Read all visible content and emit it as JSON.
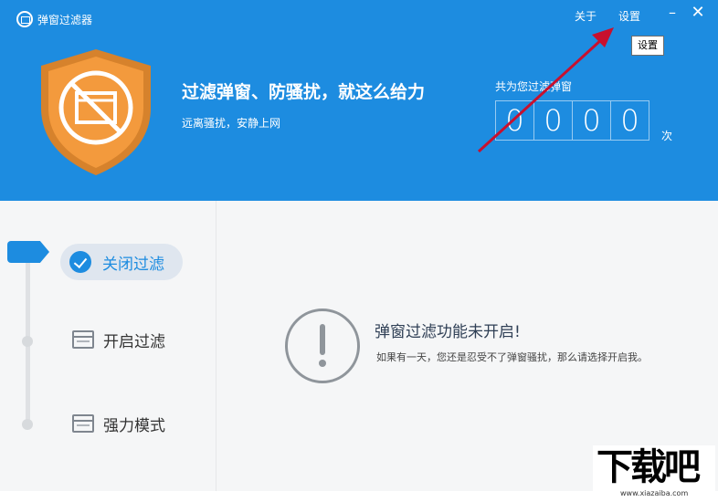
{
  "app": {
    "title": "弹窗过滤器"
  },
  "header": {
    "about": "关于",
    "settings": "设置",
    "tooltip": "设置",
    "headline": "过滤弹窗、防骚扰，就这么给力",
    "subline": "远离骚扰，安静上网",
    "count_label": "共为您过滤弹窗",
    "digits": [
      "0",
      "0",
      "0",
      "0"
    ],
    "times_unit": "次"
  },
  "sidebar": {
    "items": [
      {
        "label": "关闭过滤",
        "state": "selected"
      },
      {
        "label": "开启过滤"
      },
      {
        "label": "强力模式"
      }
    ]
  },
  "main": {
    "status_title": "弹窗过滤功能未开启!",
    "status_desc": "如果有一天，您还是忍受不了弹窗骚扰，那么请选择开启我。"
  },
  "watermark": {
    "brand": "下载吧",
    "url": "www.xiazaiba.com"
  },
  "colors": {
    "header_blue": "#1d8ce0",
    "shield_orange": "#f39a3d",
    "arrow_red": "#c8102e"
  }
}
